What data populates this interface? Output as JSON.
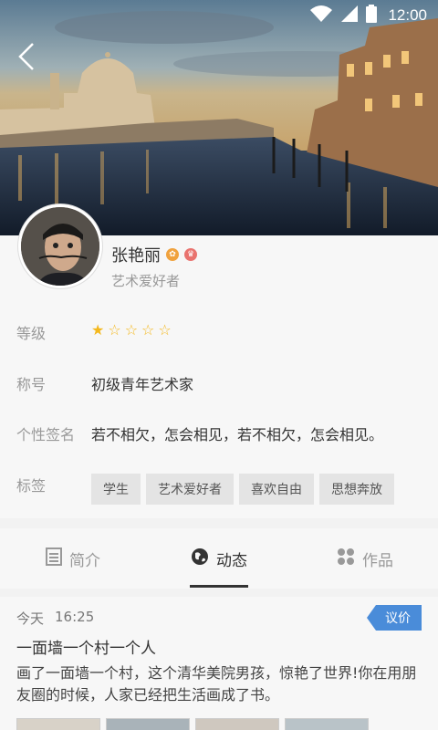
{
  "status_bar": {
    "time": "12:00"
  },
  "profile": {
    "name": "张艳丽",
    "subtitle": "艺术爱好者"
  },
  "info": {
    "level": {
      "label": "等级",
      "stars_filled": 1,
      "stars_total": 5
    },
    "title": {
      "label": "称号",
      "value": "初级青年艺术家"
    },
    "signature": {
      "label": "个性签名",
      "value": "若不相欠，怎会相见，若不相欠，怎会相见。"
    },
    "tags": {
      "label": "标签",
      "items": [
        "学生",
        "艺术爱好者",
        "喜欢自由",
        "思想奔放"
      ]
    }
  },
  "tabs": [
    {
      "label": "简介",
      "icon": "document-icon"
    },
    {
      "label": "动态",
      "icon": "globe-icon"
    },
    {
      "label": "作品",
      "icon": "grid-icon"
    }
  ],
  "feed": {
    "day": "今天",
    "time": "16:25",
    "tag": "议价",
    "title": "一面墙一个村一个人",
    "body": "画了一面墙一个村，这个清华美院男孩，惊艳了世界!你在用朋友圈的时候，人家已经把生活画成了书。"
  },
  "colors": {
    "accent_blue": "#4a8cd9",
    "star": "#f4b81c"
  }
}
